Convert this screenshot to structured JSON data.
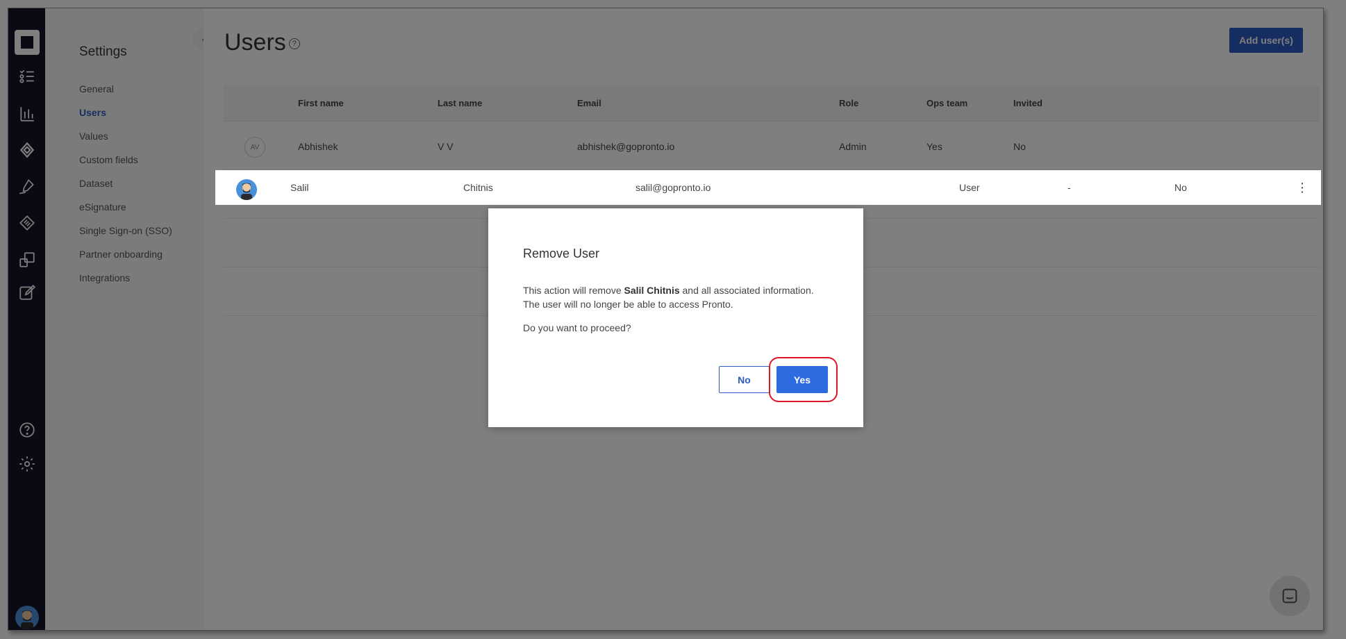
{
  "sidebar": {
    "title": "Settings",
    "items": [
      {
        "label": "General"
      },
      {
        "label": "Users"
      },
      {
        "label": "Values"
      },
      {
        "label": "Custom fields"
      },
      {
        "label": "Dataset"
      },
      {
        "label": "eSignature"
      },
      {
        "label": "Single Sign-on (SSO)"
      },
      {
        "label": "Partner onboarding"
      },
      {
        "label": "Integrations"
      }
    ],
    "active": "Users"
  },
  "header": {
    "title": "Users",
    "add_button": "Add user(s)"
  },
  "table": {
    "columns": [
      "First name",
      "Last name",
      "Email",
      "Role",
      "Ops team",
      "Invited"
    ],
    "rows": [
      {
        "initials": "AV",
        "first": "Abhishek",
        "last": "V V",
        "email": "abhishek@gopronto.io",
        "role": "Admin",
        "ops": "Yes",
        "invited": "No"
      },
      {
        "first": "Salil",
        "last": "Chitnis",
        "email": "salil@gopronto.io",
        "role": "User",
        "ops": "-",
        "invited": "No"
      }
    ]
  },
  "modal": {
    "title": "Remove User",
    "body_prefix": "This action will remove ",
    "body_name": "Salil Chitnis",
    "body_suffix": " and all associated information.",
    "body_line2": "The user will no longer be able to access Pronto.",
    "question": "Do you want to proceed?",
    "no_label": "No",
    "yes_label": "Yes"
  },
  "colors": {
    "accent": "#2d5bc4",
    "rail": "#141428",
    "highlight_ring": "#e0152a"
  }
}
